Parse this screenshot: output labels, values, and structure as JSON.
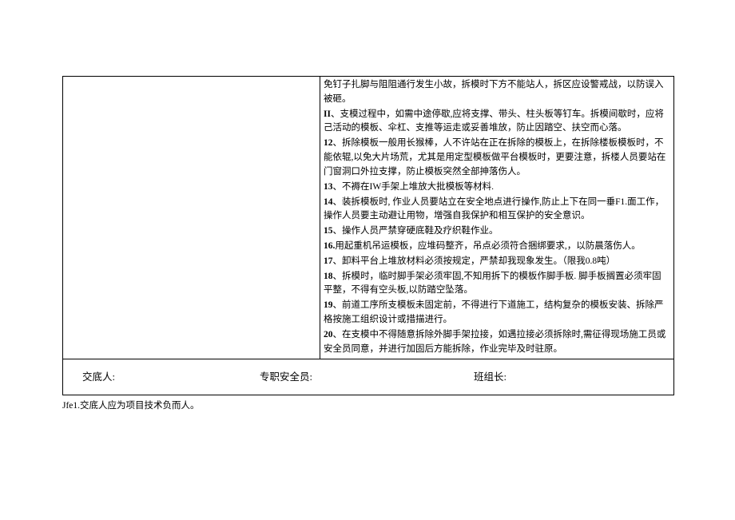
{
  "content": {
    "line1": "免钉子扎脚与阻阻通行发生小故，拆模时下方不能站人，拆区应设警戒战，以防误入被砸。",
    "line2_num": "II",
    "line2_text": "、支模过程中，如需中途停歇,应将支撑、带头、柱头板等钉车。拆模间歇时，应将己活动的模板、伞杠、支推等运走或妥善堆放，防止因踏空、扶空而心落。",
    "line12_num": "12",
    "line12_text": "、拆除模板一般用长猴棒，人不许站在正在拆除的模板上，在拆除楼板模板时，不能依辊,以免大片场荒，尤其是用定型模板做平台模板时，更要注意，拆楼人员要站在门窗洞口外拉支撑，防止模板突然全部抻落伤人。",
    "line13_num": "13",
    "line13_text": "、不褥在IW手架上堆放大批模板等材料.",
    "line14_num": "14",
    "line14_text": "、装拆模板时, 作业人员要站立在安全地点进行操作,防止上下在同一垂F1.面工作，操作人员要主动避让用物，增强自我保护和相互保护的安全意识。",
    "line15_num": "15",
    "line15_text": "、操作人员严禁穿硬底鞋及疗织鞋作业。",
    "line16_num": "16.",
    "line16_text": "用起重机吊运模板，应堆码整齐，吊点必须符合捆绑要求,，以防晨落伤人。",
    "line17_num": "17",
    "line17_text": "、卸料平台上堆放材料必须按规定，严禁却我现象发生。（限我0.8吨）",
    "line18_num": "18",
    "line18_text": "、拆模时，临时脚手架必须牢固,不知用拆下的模板作脚手板. 脚手板搁置必须牢固平整，不得有空头板,以防踏空坠落。",
    "line19_num": "19",
    "line19_text": "、前道工序所支模板未固定前，不得进行下道施工，结构复杂的模板安装、拆除严格按施工组织设计或措描进行。",
    "line20_num": "20",
    "line20_text": "、在支模中不得随意拆除外脚手架拉接，如遇拉接必须拆除时,需征得现场施工员或安全员同意，并进行加固后方能拆除，作业完毕及时驻原。"
  },
  "signatures": {
    "s1": "交底人:",
    "s2": "专职安全员:",
    "s3": "班组长:"
  },
  "footnote": "Jfe1.交底人应为项目技术负而人。"
}
